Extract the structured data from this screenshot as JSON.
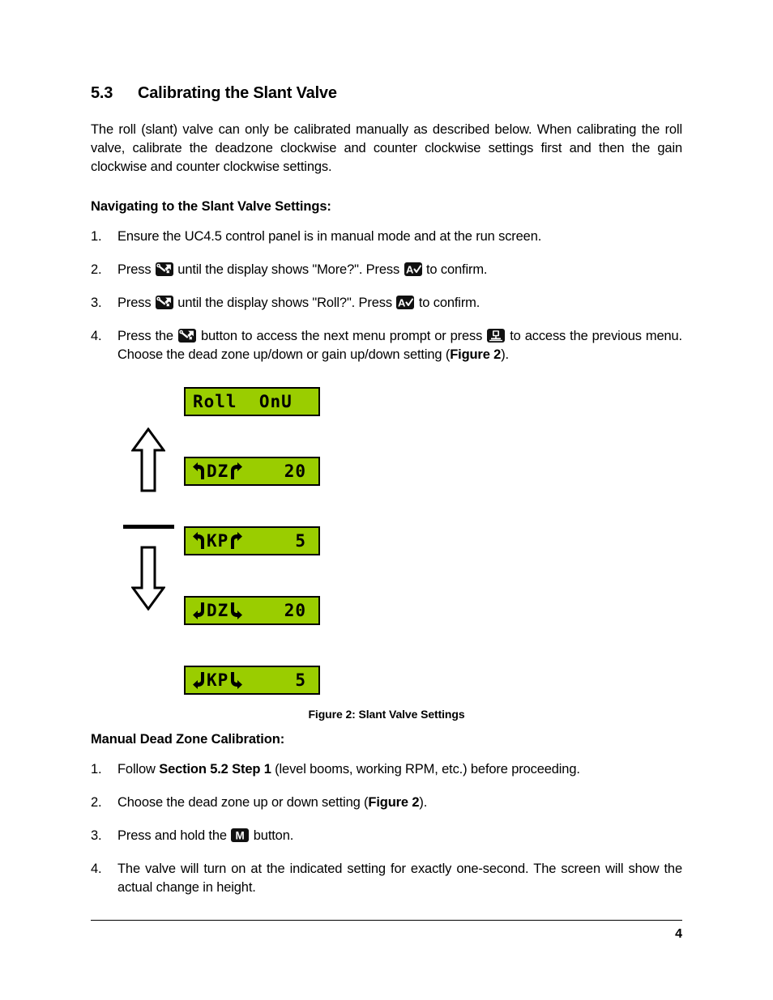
{
  "document": {
    "section": {
      "number": "5.3",
      "title": "Calibrating the Slant Valve"
    },
    "intro_paragraph": "The roll (slant) valve can only be calibrated manually as described below.  When calibrating the roll valve, calibrate the deadzone clockwise and counter clockwise settings first and then the gain clockwise and counter clockwise settings.",
    "navigating": {
      "heading": "Navigating to the Slant Valve Settings:",
      "steps": [
        {
          "marker": "1.",
          "parts": [
            {
              "type": "text",
              "text": "Ensure the UC4.5 control panel is in manual mode and at the run screen."
            }
          ]
        },
        {
          "marker": "2.",
          "parts": [
            {
              "type": "text",
              "text": "Press "
            },
            {
              "type": "icon",
              "icon": "wrench-x-icon"
            },
            {
              "type": "text",
              "text": " until the display shows \"More?\". Press "
            },
            {
              "type": "icon",
              "icon": "a-check-icon"
            },
            {
              "type": "text",
              "text": " to confirm."
            }
          ]
        },
        {
          "marker": "3.",
          "parts": [
            {
              "type": "text",
              "text": "Press "
            },
            {
              "type": "icon",
              "icon": "wrench-x-icon"
            },
            {
              "type": "text",
              "text": " until the display shows \"Roll?\".  Press "
            },
            {
              "type": "icon",
              "icon": "a-check-icon"
            },
            {
              "type": "text",
              "text": " to confirm."
            }
          ]
        },
        {
          "marker": "4.",
          "parts": [
            {
              "type": "text",
              "text": "Press the "
            },
            {
              "type": "icon",
              "icon": "wrench-x-icon"
            },
            {
              "type": "text",
              "text": " button to access the next menu prompt or press "
            },
            {
              "type": "icon",
              "icon": "boom-raise-icon"
            },
            {
              "type": "text",
              "text": " to access the previous menu.  Choose the dead zone up/down or gain up/down setting ("
            },
            {
              "type": "bold",
              "text": "Figure 2"
            },
            {
              "type": "text",
              "text": ")."
            }
          ]
        }
      ]
    },
    "figure": {
      "caption": "Figure 2:  Slant Valve Settings",
      "lcd_screens": [
        {
          "id": "roll-onu",
          "left_arrow": "none",
          "label": "Roll",
          "right_arrow": "none",
          "value": "OnU",
          "display_text": "Roll  OnU"
        },
        {
          "id": "dz-up",
          "left_arrow": "ccw-up",
          "label": "DZ",
          "right_arrow": "cw-up",
          "value": "20"
        },
        {
          "id": "kp-up",
          "left_arrow": "ccw-up",
          "label": "KP",
          "right_arrow": "cw-up",
          "value": "5"
        },
        {
          "id": "dz-down",
          "left_arrow": "cw-down",
          "label": "DZ",
          "right_arrow": "ccw-down",
          "value": "20"
        },
        {
          "id": "kp-down",
          "left_arrow": "cw-down",
          "label": "KP",
          "right_arrow": "ccw-down",
          "value": "5"
        }
      ],
      "nav_arrows": {
        "up": "up-arrow-outline",
        "separator": "horizontal-rule",
        "down": "down-arrow-outline"
      }
    },
    "manual_calibration": {
      "heading": "Manual Dead Zone Calibration:",
      "steps": [
        {
          "marker": "1.",
          "parts": [
            {
              "type": "text",
              "text": "Follow "
            },
            {
              "type": "bold",
              "text": "Section 5.2 Step 1"
            },
            {
              "type": "text",
              "text": " (level booms, working RPM, etc.) before proceeding."
            }
          ]
        },
        {
          "marker": "2.",
          "parts": [
            {
              "type": "text",
              "text": "Choose the dead zone up or down setting ("
            },
            {
              "type": "bold",
              "text": "Figure 2"
            },
            {
              "type": "text",
              "text": ")."
            }
          ]
        },
        {
          "marker": "3.",
          "parts": [
            {
              "type": "text",
              "text": "Press and hold the "
            },
            {
              "type": "icon",
              "icon": "m-button-icon"
            },
            {
              "type": "text",
              "text": " button."
            }
          ]
        },
        {
          "marker": "4.",
          "parts": [
            {
              "type": "text",
              "text": "The valve will turn on at the indicated setting for exactly one-second.  The screen will show the actual change in height."
            }
          ]
        }
      ]
    },
    "footer": {
      "page_number": "4"
    },
    "colors": {
      "lcd_background": "#9ACD00",
      "lcd_border": "#000000",
      "text": "#000000",
      "icon_background": "#111111"
    }
  }
}
